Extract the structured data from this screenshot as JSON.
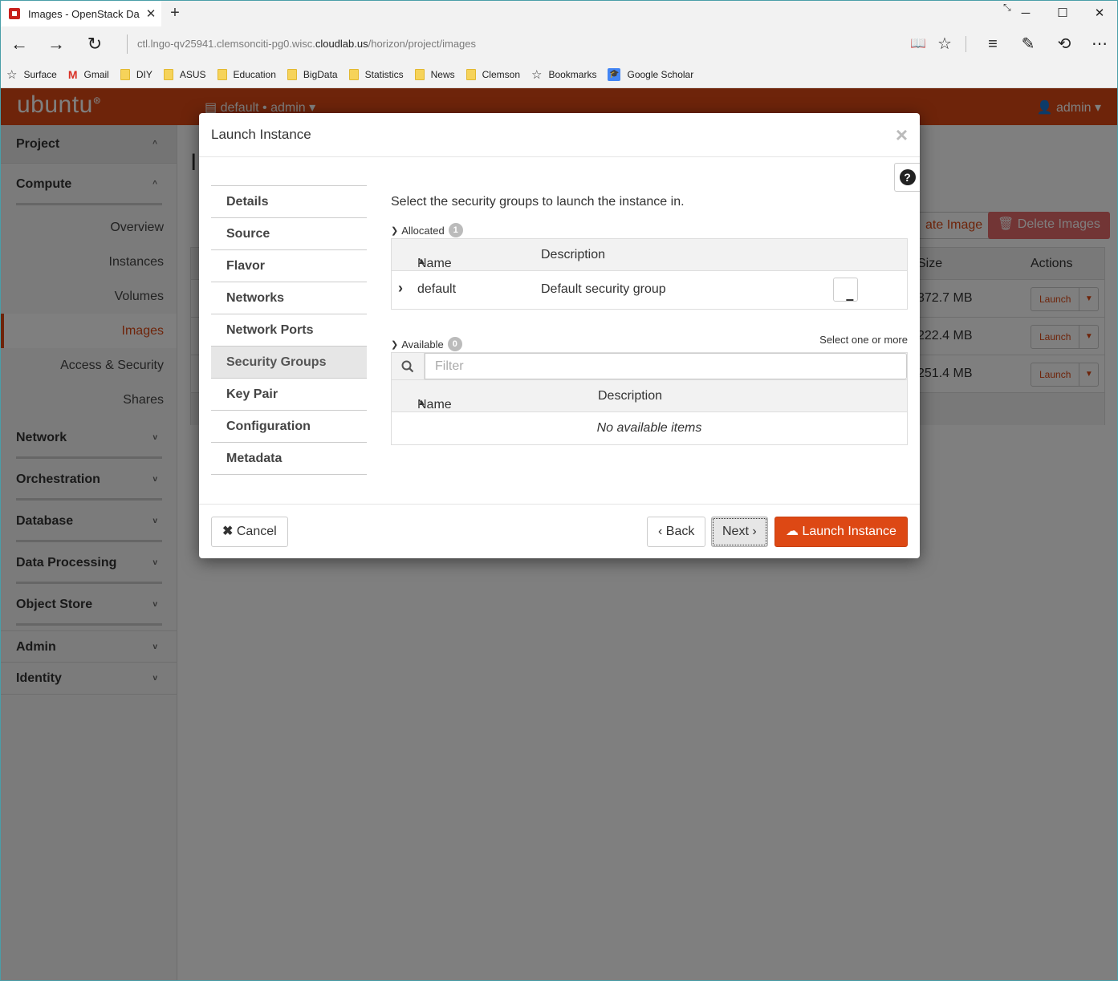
{
  "browser": {
    "tab_title": "Images - OpenStack Da",
    "tab_close": "✕",
    "new_tab": "+",
    "url_prefix": "ctl.lngo-qv25941.clemsonciti-pg0.wisc.",
    "url_host": "cloudlab.us",
    "url_path": "/horizon/project/images",
    "favorites": [
      {
        "label": "Surface",
        "icon": "star-icon"
      },
      {
        "label": "Gmail",
        "icon": "gmail-icon"
      },
      {
        "label": "DIY",
        "icon": "folder-icon"
      },
      {
        "label": "ASUS",
        "icon": "folder-icon"
      },
      {
        "label": "Education",
        "icon": "folder-icon"
      },
      {
        "label": "BigData",
        "icon": "folder-icon"
      },
      {
        "label": "Statistics",
        "icon": "folder-icon"
      },
      {
        "label": "News",
        "icon": "folder-icon"
      },
      {
        "label": "Clemson",
        "icon": "folder-icon"
      },
      {
        "label": "Bookmarks",
        "icon": "star-icon"
      },
      {
        "label": "Google Scholar",
        "icon": "google-scholar-icon"
      }
    ]
  },
  "header": {
    "brand": "ubuntu",
    "project_selector": "default • admin",
    "user": "admin"
  },
  "sidebar": {
    "project": "Project",
    "compute": "Compute",
    "compute_items": [
      "Overview",
      "Instances",
      "Volumes",
      "Images",
      "Access & Security",
      "Shares"
    ],
    "groups": [
      "Network",
      "Orchestration",
      "Database",
      "Data Processing",
      "Object Store"
    ],
    "admin": "Admin",
    "identity": "Identity"
  },
  "background_page": {
    "title": "I",
    "create_image": "ate Image",
    "delete_images": "Delete Images",
    "col_size": "Size",
    "col_actions": "Actions",
    "rows": [
      {
        "size": "372.7 MB",
        "action": "Launch"
      },
      {
        "size": "222.4 MB",
        "action": "Launch"
      },
      {
        "size": "251.4 MB",
        "action": "Launch"
      }
    ]
  },
  "modal": {
    "title": "Launch Instance",
    "close": "×",
    "help": "?",
    "steps": [
      "Details",
      "Source",
      "Flavor",
      "Networks",
      "Network Ports",
      "Security Groups",
      "Key Pair",
      "Configuration",
      "Metadata"
    ],
    "active_step": "Security Groups",
    "help_text": "Select the security groups to launch the instance in.",
    "allocated_label": "Allocated",
    "allocated_count": "1",
    "available_label": "Available",
    "available_count": "0",
    "select_hint": "Select one or more",
    "col_name": "Name",
    "col_description": "Description",
    "allocated_rows": [
      {
        "name": "default",
        "description": "Default security group"
      }
    ],
    "filter_placeholder": "Filter",
    "empty_text": "No available items",
    "buttons": {
      "cancel": "Cancel",
      "back": "Back",
      "next": "Next",
      "launch": "Launch Instance"
    }
  },
  "colors": {
    "accent": "#dd4814",
    "danger": "#e46b6b"
  }
}
